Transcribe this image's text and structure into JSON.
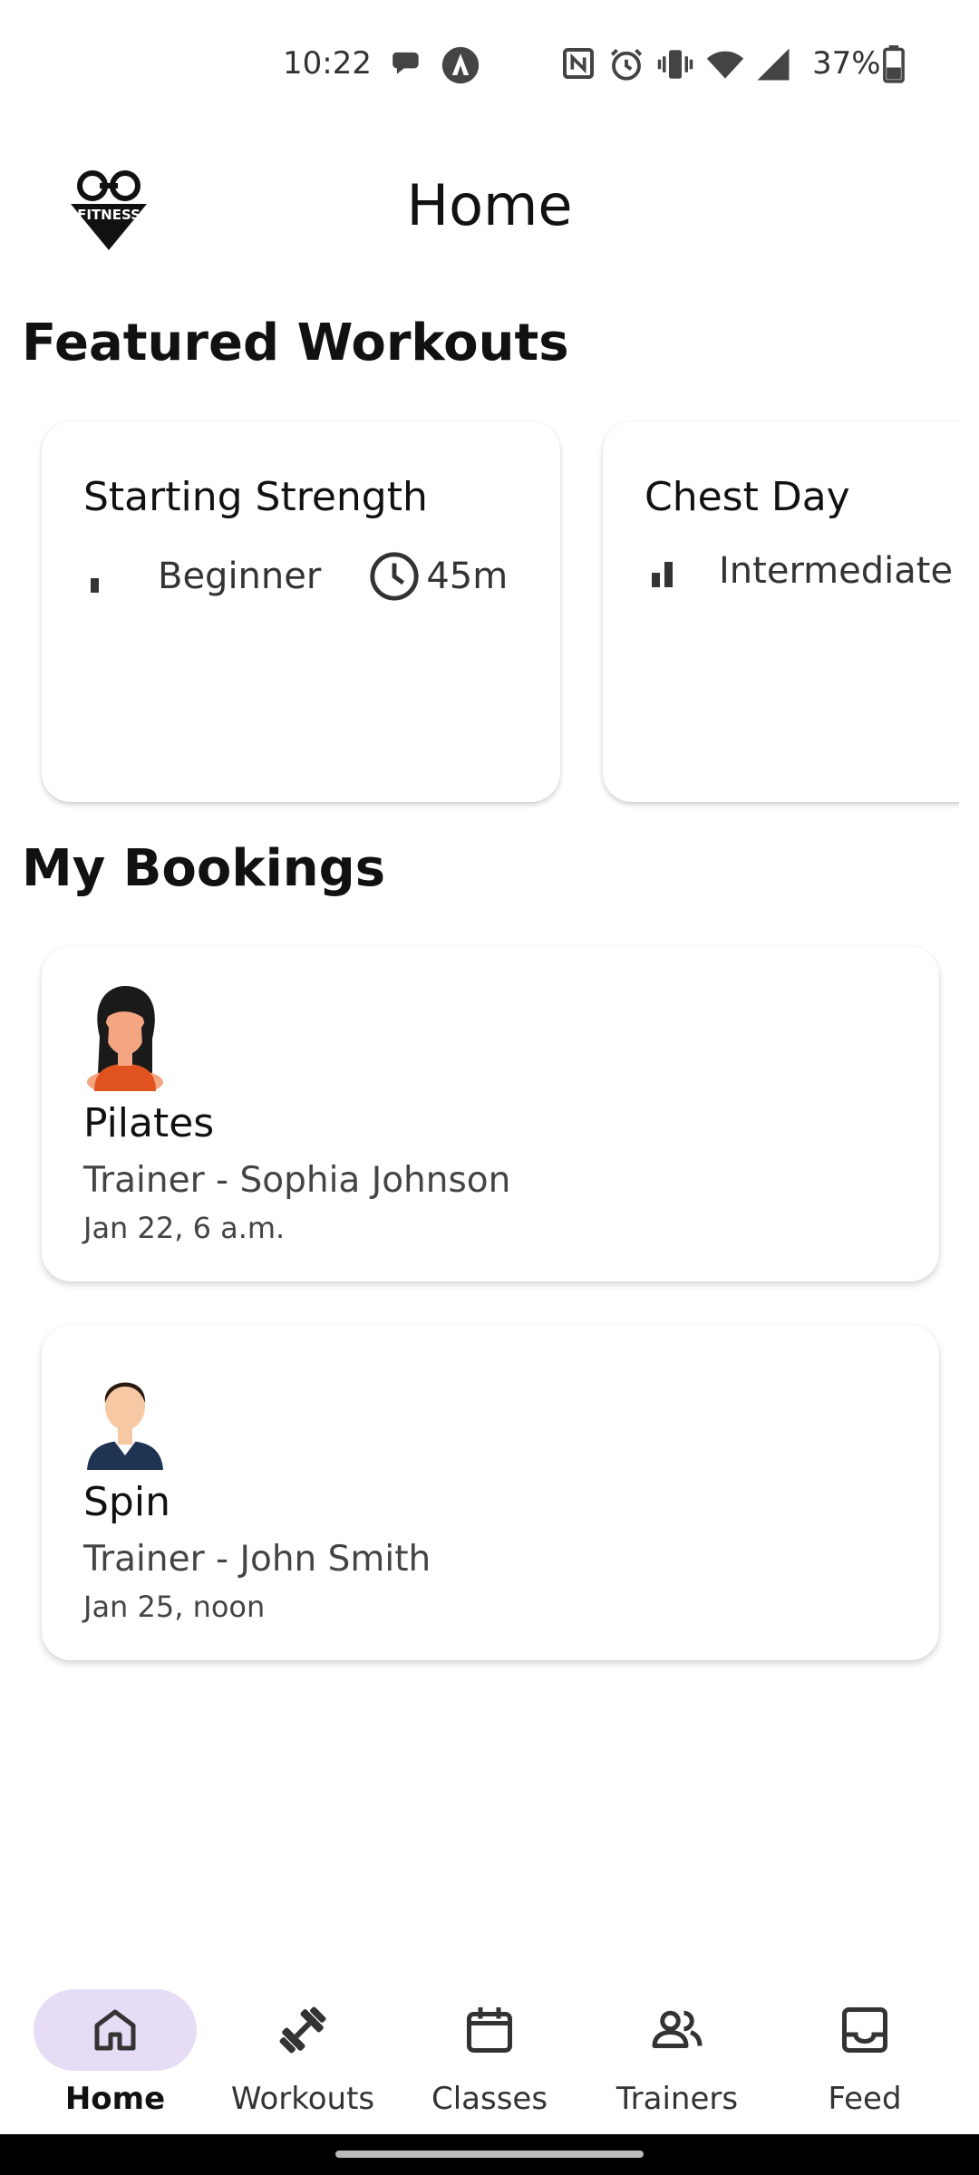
{
  "status_bar": {
    "time": "10:22",
    "battery": "37%",
    "icons": [
      "chat-bubble-icon",
      "navigation-app-icon",
      "nfc-icon",
      "alarm-icon",
      "vibrate-icon",
      "wifi-icon",
      "signal-icon",
      "battery-icon"
    ]
  },
  "app_bar": {
    "title": "Home",
    "logo_text": "FITNESS"
  },
  "featured": {
    "title": "Featured Workouts",
    "workouts": [
      {
        "name": "Starting Strength",
        "level": "Beginner",
        "duration": "45m"
      },
      {
        "name": "Chest Day",
        "level": "Intermediate"
      }
    ]
  },
  "bookings": {
    "title": "My Bookings",
    "items": [
      {
        "class": "Pilates",
        "trainer": "Trainer - Sophia Johnson",
        "date": "Jan 22, 6 a.m.",
        "avatar": "female-avatar"
      },
      {
        "class": "Spin",
        "trainer": "Trainer - John Smith",
        "date": "Jan 25, noon",
        "avatar": "male-avatar"
      }
    ]
  },
  "bottom_nav": {
    "items": [
      {
        "label": "Home",
        "icon": "home-icon",
        "active": true
      },
      {
        "label": "Workouts",
        "icon": "dumbbell-icon",
        "active": false
      },
      {
        "label": "Classes",
        "icon": "calendar-icon",
        "active": false
      },
      {
        "label": "Trainers",
        "icon": "people-icon",
        "active": false
      },
      {
        "label": "Feed",
        "icon": "inbox-icon",
        "active": false
      }
    ]
  },
  "colors": {
    "active_nav_pill": "#e6dcf5",
    "text_primary": "#111111",
    "text_secondary": "#444444"
  }
}
